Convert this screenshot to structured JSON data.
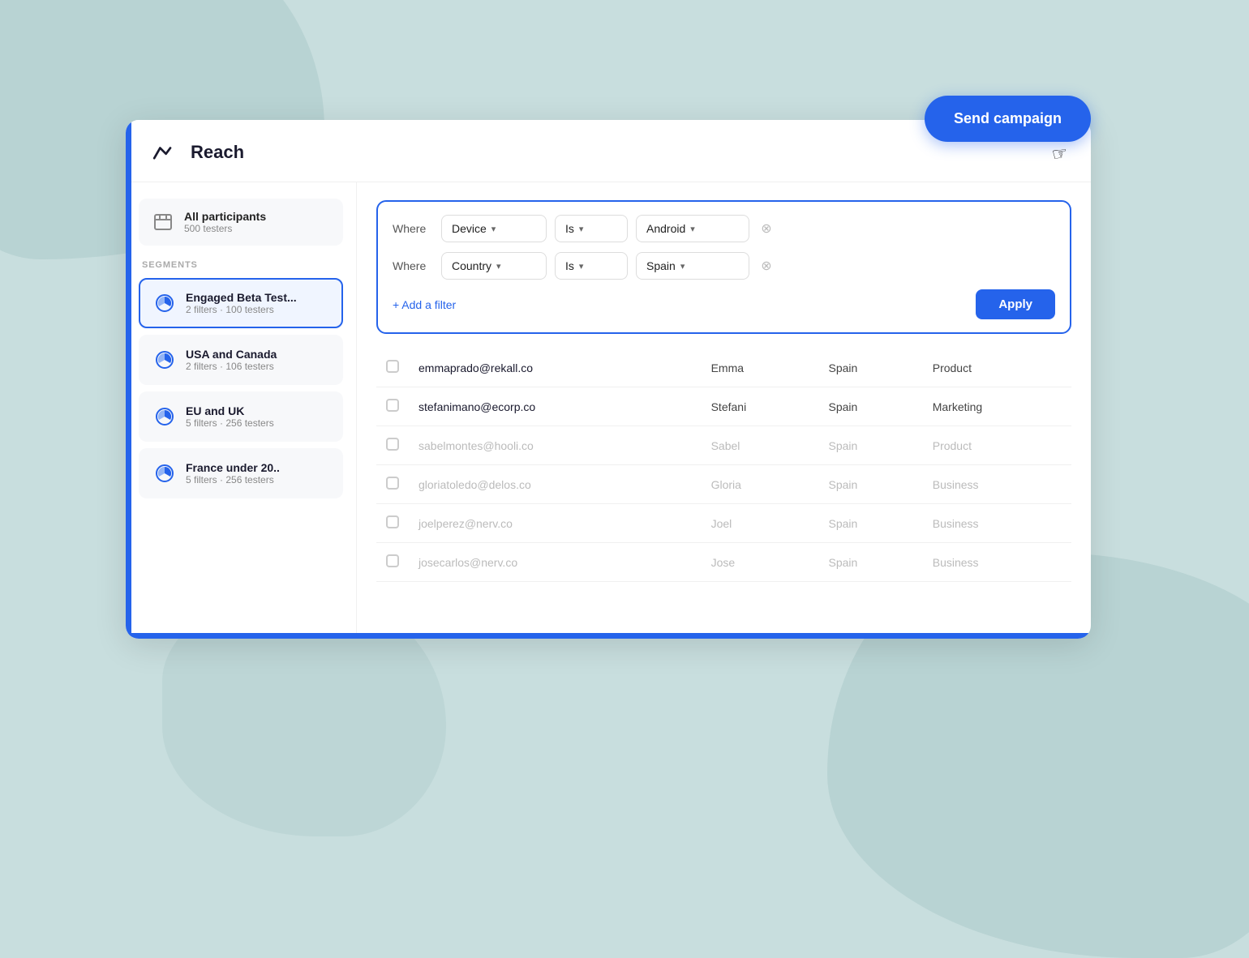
{
  "app": {
    "title": "Reach",
    "logo_alt": "maze-logo"
  },
  "send_campaign_btn": "Send campaign",
  "sidebar": {
    "all_participants": {
      "label": "All participants",
      "count": "500 testers"
    },
    "segments_label": "SEGMENTS",
    "segments": [
      {
        "id": "engaged-beta",
        "title": "Engaged Beta Test...",
        "subtitle": "2 filters · 100 testers",
        "active": true
      },
      {
        "id": "usa-canada",
        "title": "USA and Canada",
        "subtitle": "2 filters · 106 testers",
        "active": false
      },
      {
        "id": "eu-uk",
        "title": "EU and UK",
        "subtitle": "5 filters · 256 testers",
        "active": false
      },
      {
        "id": "france-under-20",
        "title": "France under 20..",
        "subtitle": "5 filters · 256 testers",
        "active": false
      }
    ]
  },
  "filters": {
    "filter1": {
      "where_label": "Where",
      "field": "Device",
      "operator": "Is",
      "value": "Android"
    },
    "filter2": {
      "where_label": "Where",
      "field": "Country",
      "operator": "Is",
      "value": "Spain"
    },
    "add_filter_label": "+ Add a filter",
    "apply_label": "Apply"
  },
  "table": {
    "rows": [
      {
        "email": "emmaprado@rekall.co",
        "name": "Emma",
        "country": "Spain",
        "role": "Product",
        "muted": false
      },
      {
        "email": "stefanimano@ecorp.co",
        "name": "Stefani",
        "country": "Spain",
        "role": "Marketing",
        "muted": false
      },
      {
        "email": "sabelmontes@hooli.co",
        "name": "Sabel",
        "country": "Spain",
        "role": "Product",
        "muted": true
      },
      {
        "email": "gloriatoledo@delos.co",
        "name": "Gloria",
        "country": "Spain",
        "role": "Business",
        "muted": true
      },
      {
        "email": "joelperez@nerv.co",
        "name": "Joel",
        "country": "Spain",
        "role": "Business",
        "muted": true
      },
      {
        "email": "josecarlos@nerv.co",
        "name": "Jose",
        "country": "Spain",
        "role": "Business",
        "muted": true
      }
    ]
  }
}
